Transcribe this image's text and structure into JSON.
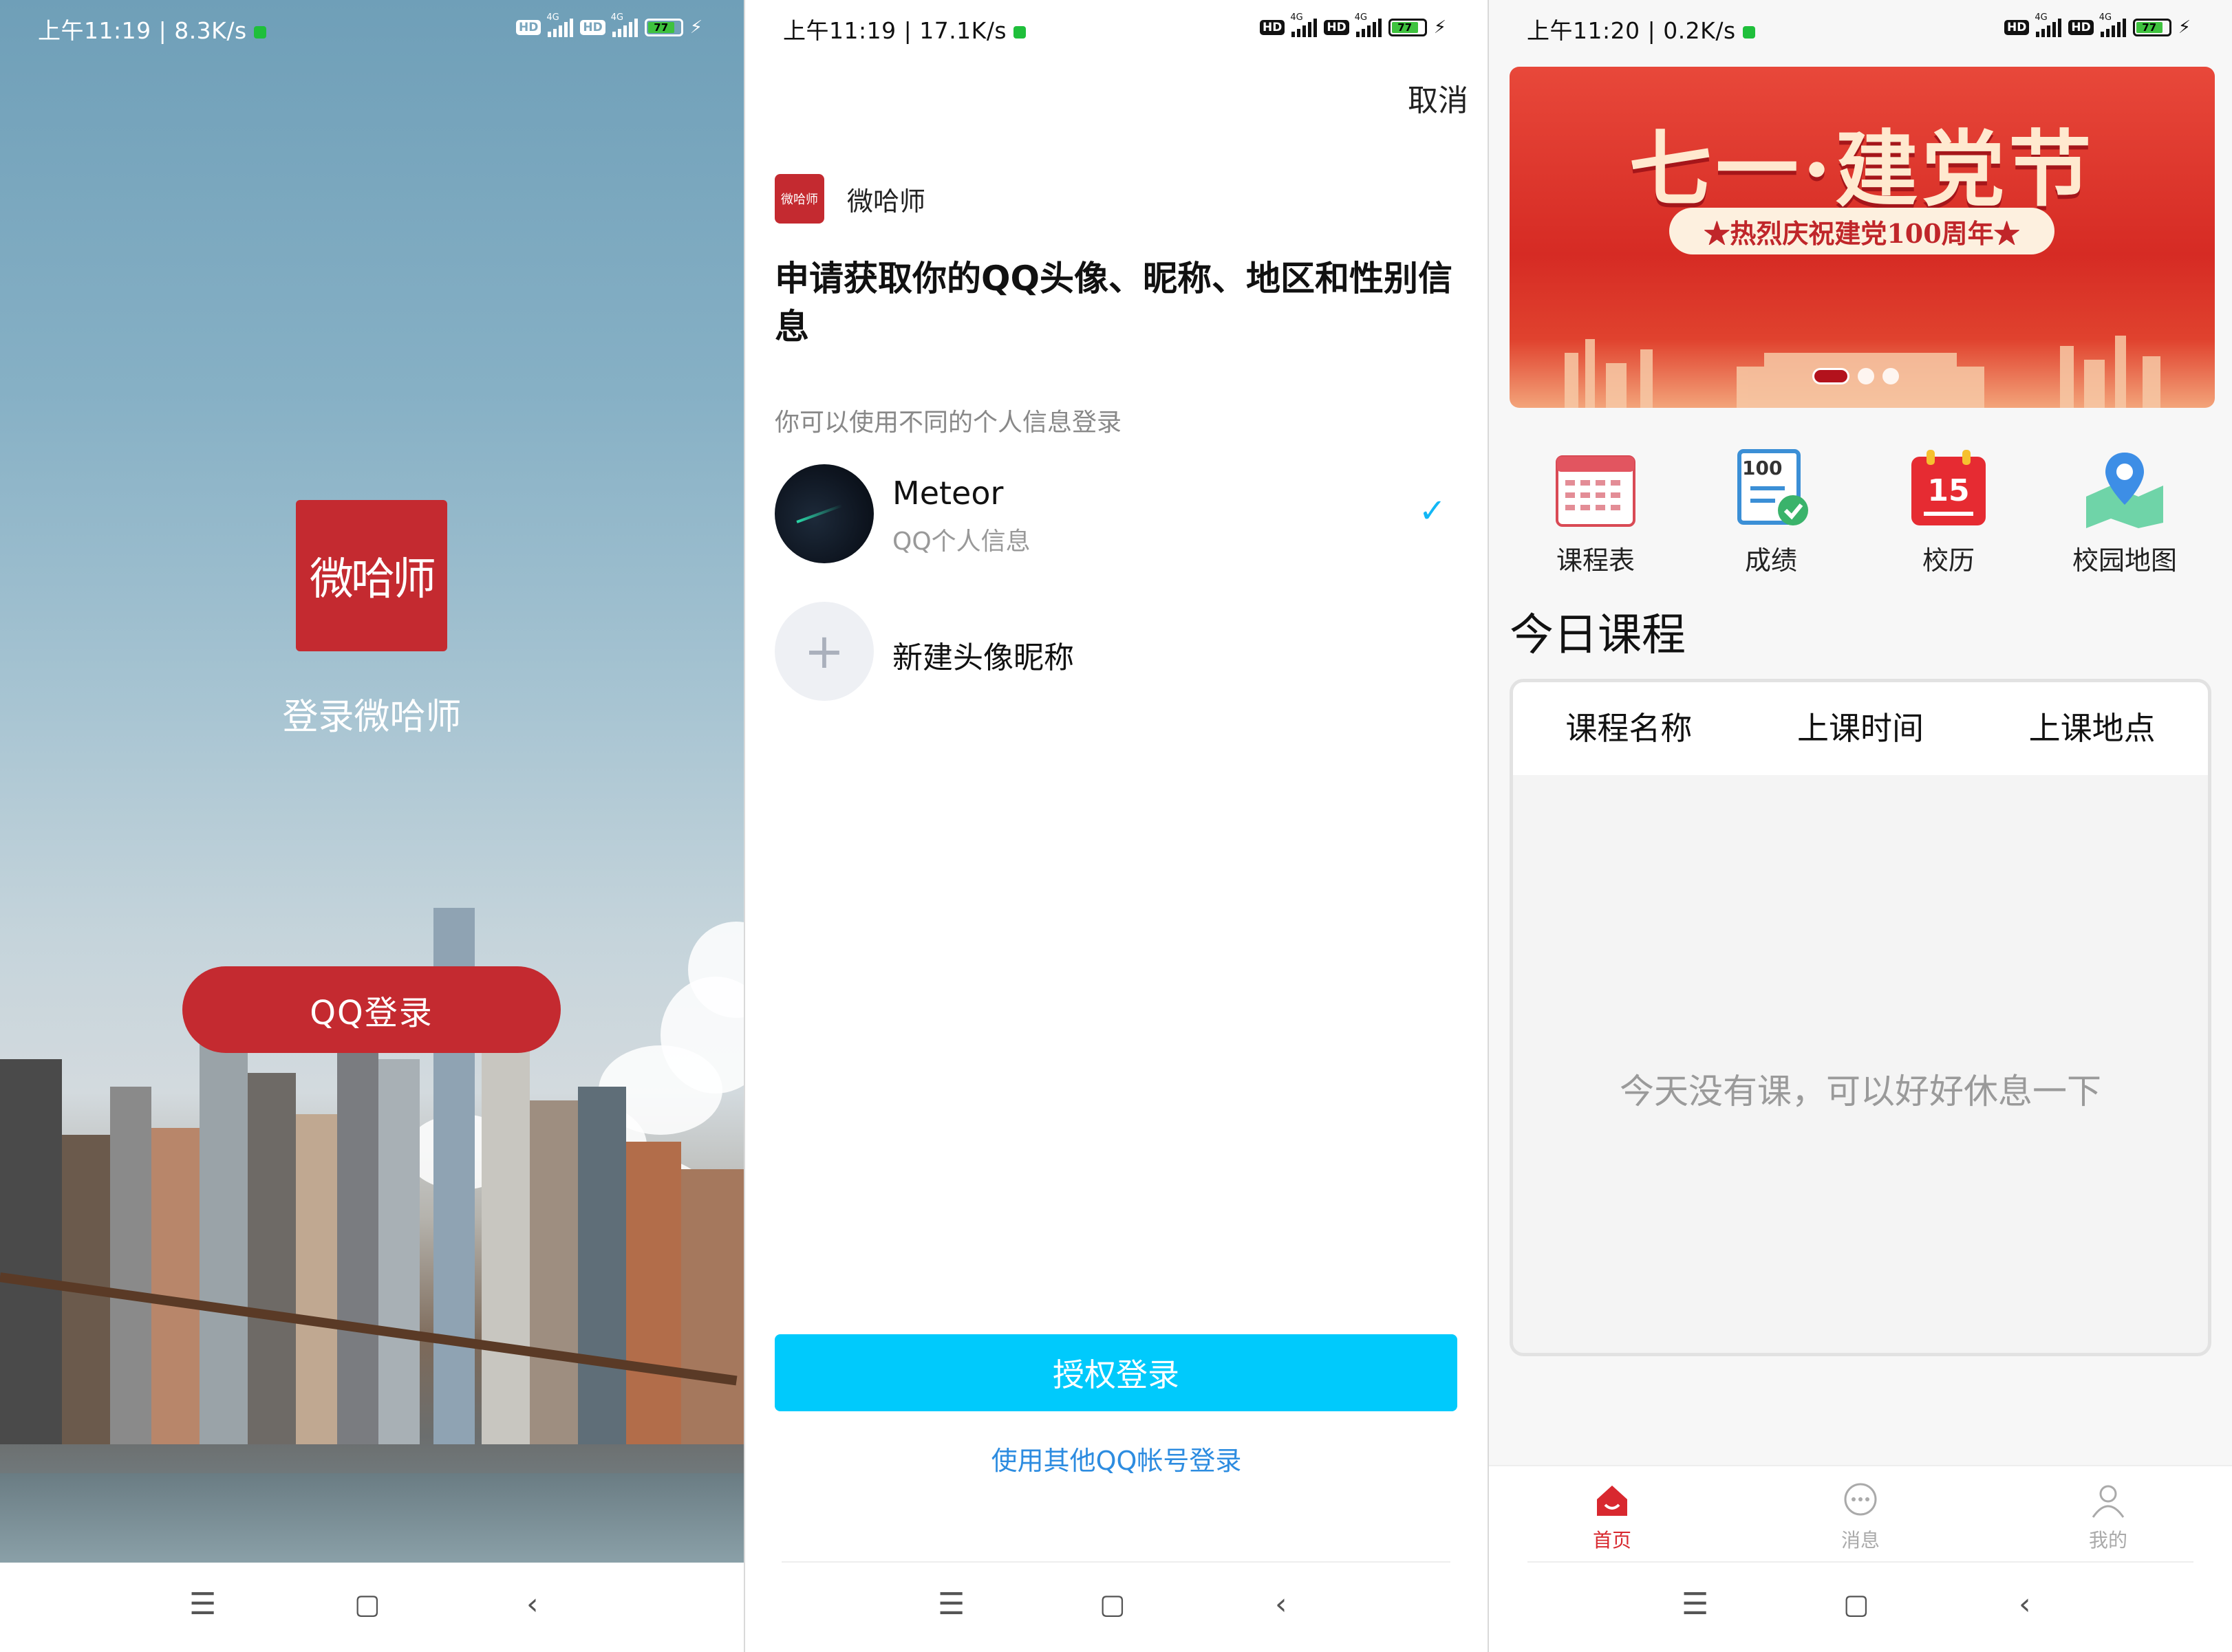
{
  "screens": [
    {
      "status": {
        "time": "上午11:19 | 8.3K/s",
        "battery": "77"
      },
      "app_title": "登录微哈师",
      "logo_text": "微哈师",
      "qq_login_label": "QQ登录"
    },
    {
      "status": {
        "time": "上午11:19 | 17.1K/s",
        "battery": "77"
      },
      "cancel_label": "取消",
      "app_name": "微哈师",
      "app_logo_text": "微哈师",
      "request_text": "申请获取你的QQ头像、昵称、地区和性别信息",
      "hint_text": "你可以使用不同的个人信息登录",
      "account": {
        "name": "Meteor",
        "subtitle": "QQ个人信息"
      },
      "new_profile_label": "新建头像昵称",
      "authorize_label": "授权登录",
      "other_account_label": "使用其他QQ帐号登录"
    },
    {
      "status": {
        "time": "上午11:20 | 0.2K/s",
        "battery": "77"
      },
      "banner": {
        "title": "七一·建党节",
        "subtitle": "★热烈庆祝建党100周年★"
      },
      "quick_actions": [
        {
          "label": "课程表",
          "icon": "timetable-icon"
        },
        {
          "label": "成绩",
          "icon": "grades-icon",
          "icon_text": "100"
        },
        {
          "label": "校历",
          "icon": "calendar-icon",
          "icon_text": "15"
        },
        {
          "label": "校园地图",
          "icon": "map-icon"
        }
      ],
      "today_title": "今日课程",
      "table_headers": [
        "课程名称",
        "上课时间",
        "上课地点"
      ],
      "empty_text": "今天没有课，可以好好休息一下",
      "tabs": [
        {
          "label": "首页",
          "icon": "home-icon"
        },
        {
          "label": "消息",
          "icon": "message-icon"
        },
        {
          "label": "我的",
          "icon": "profile-icon"
        }
      ]
    }
  ],
  "colors": {
    "brand_red": "#c42a30",
    "qq_blue": "#00cafc",
    "link_blue": "#2d8ce0",
    "check_blue": "#12b7f5"
  }
}
